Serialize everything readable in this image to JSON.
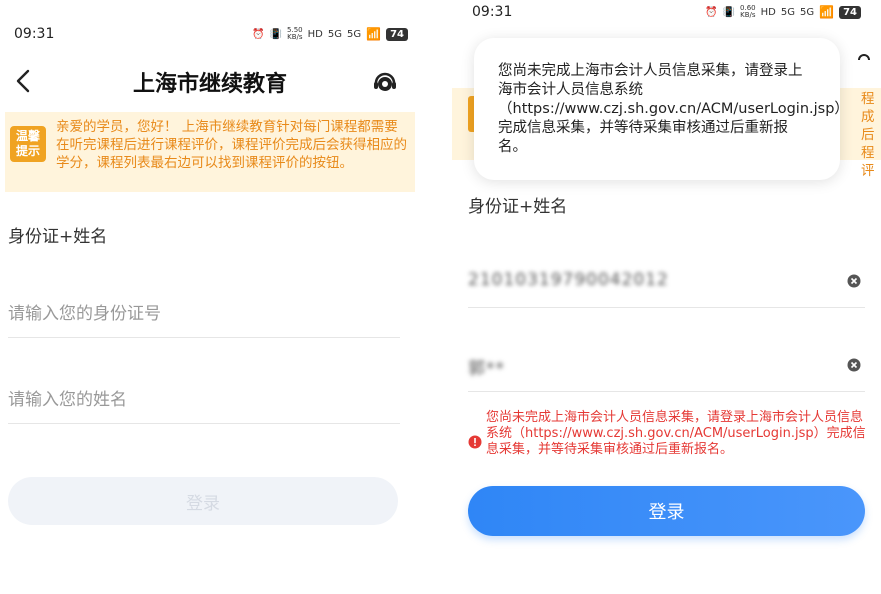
{
  "left": {
    "status": {
      "time": "09:31",
      "net_speed_value": "5.50",
      "net_speed_unit": "KB/s",
      "hd": "HD",
      "sig1": "5G",
      "sig2": "5G",
      "battery": "74"
    },
    "nav": {
      "title": "上海市继续教育"
    },
    "notice": {
      "badge_line1": "温馨",
      "badge_line2": "提示",
      "text": "亲爱的学员，您好！ 上海市继续教育针对每门课程都需要在听完课程后进行课程评价，课程评价完成后会获得相应的学分，课程列表最右边可以找到课程评价的按钮。"
    },
    "form": {
      "section_label": "身份证+姓名",
      "id_placeholder": "请输入您的身份证号",
      "name_placeholder": "请输入您的姓名",
      "login_label": "登录"
    }
  },
  "right": {
    "status": {
      "time": "09:31",
      "net_speed_value": "0.60",
      "net_speed_unit": "KB/s",
      "hd": "HD",
      "sig1": "5G",
      "sig2": "5G",
      "battery": "74"
    },
    "bg_notice_fragment": "程\n成后\n程评",
    "toast": {
      "message": "您尚未完成上海市会计人员信息采集，请登录上海市会计人员信息系统（https://www.czj.sh.gov.cn/ACM/userLogin.jsp）完成信息采集，并等待采集审核通过后重新报名。"
    },
    "form": {
      "section_label": "身份证+姓名",
      "id_value": "21010319790042012",
      "name_value": "郭**",
      "error": "您尚未完成上海市会计人员信息采集，请登录上海市会计人员信息系统（https://www.czj.sh.gov.cn/ACM/userLogin.jsp）完成信息采集，并等待采集审核通过后重新报名。",
      "login_label": "登录"
    }
  },
  "colors": {
    "accent": "#2f86f6",
    "notice_bg": "#fff4dc",
    "notice_text": "#e88a1a",
    "error": "#e53935"
  }
}
